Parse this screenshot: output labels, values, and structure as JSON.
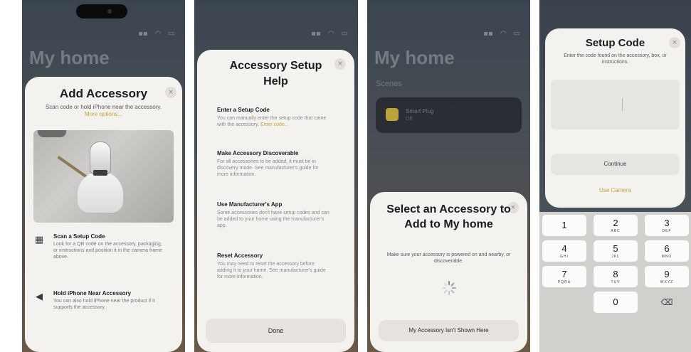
{
  "panel1": {
    "bg_title": "My home",
    "title": "Add Accessory",
    "desc": "Scan code or hold iPhone near the accessory.",
    "desc_link": "More options...",
    "options": [
      {
        "icon": "qr-code-icon",
        "heading": "Scan a Setup Code",
        "body": "Look for a QR code on the accessory, packaging, or instructions and position it in the camera frame above."
      },
      {
        "icon": "speaker-icon",
        "heading": "Hold iPhone Near Accessory",
        "body": "You can also hold iPhone near the product if it supports the accessory."
      }
    ]
  },
  "panel2": {
    "bg_title": "My home",
    "title": "Accessory Setup Help",
    "sections": [
      {
        "heading": "Enter a Setup Code",
        "body": "You can manually enter the setup code that came with the accessory.",
        "link": "Enter code..."
      },
      {
        "heading": "Make Accessory Discoverable",
        "body": "For all accessories to be added, it must be in discovery mode. See manufacturer's guide for more information."
      },
      {
        "heading": "Use Manufacturer's App",
        "body": "Some accessories don't have setup codes and can be added to your home using the manufacturer's app."
      },
      {
        "heading": "Reset Accessory",
        "body": "You may need to reset the accessory before adding it to your home. See manufacturer's guide for more information."
      }
    ],
    "done_label": "Done"
  },
  "panel3": {
    "bg_title": "My home",
    "bg_subtitle": "Scenes",
    "tile_title": "Smart Plug",
    "tile_subtitle": "Off",
    "title": "Select an Accessory to Add to My home",
    "desc": "Make sure your accessory is powered on and nearby, or discoverable.",
    "not_shown_label": "My Accessory Isn't Shown Here"
  },
  "panel4": {
    "title": "Setup Code",
    "desc": "Enter the code found on the accessory, box, or instructions.",
    "continue_label": "Continue",
    "use_camera_label": "Use Camera",
    "keys": [
      {
        "n": "1",
        "l": ""
      },
      {
        "n": "2",
        "l": "ABC"
      },
      {
        "n": "3",
        "l": "DEF"
      },
      {
        "n": "4",
        "l": "GHI"
      },
      {
        "n": "5",
        "l": "JKL"
      },
      {
        "n": "6",
        "l": "MNO"
      },
      {
        "n": "7",
        "l": "PQRS"
      },
      {
        "n": "8",
        "l": "TUV"
      },
      {
        "n": "9",
        "l": "WXYZ"
      },
      {
        "n": "0",
        "l": ""
      }
    ]
  },
  "close_glyph": "×",
  "delete_glyph": "⌫",
  "colors": {
    "accent": "#c5a23a",
    "sheet": "#f4f2ee"
  }
}
